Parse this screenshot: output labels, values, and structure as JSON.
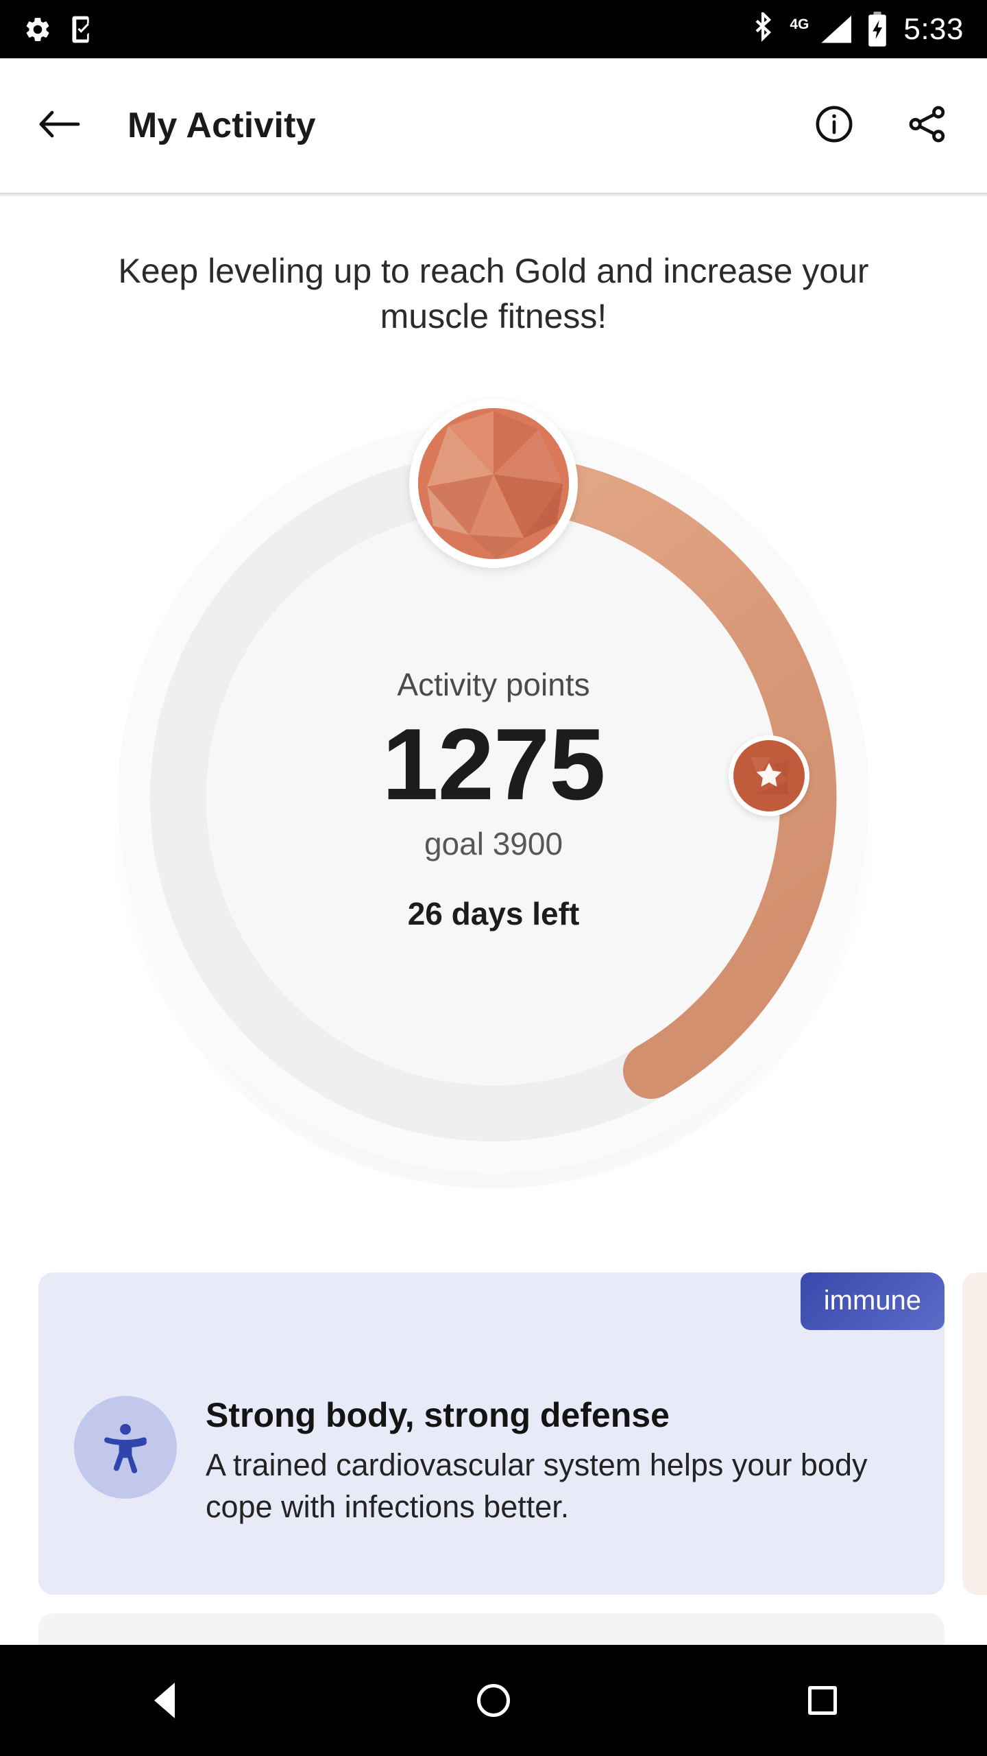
{
  "statusbar": {
    "time": "5:33",
    "network_label": "4G",
    "icons": [
      "settings-gear-icon",
      "phone-check-icon",
      "bluetooth-icon",
      "signal-4g-icon",
      "battery-charging-icon"
    ]
  },
  "appbar": {
    "title": "My Activity",
    "back_label": "Back",
    "info_label": "Info",
    "share_label": "Share"
  },
  "headline": "Keep leveling up to reach Gold and increase your muscle fitness!",
  "ring": {
    "label": "Activity points",
    "value": "1275",
    "goal": "goal 3900",
    "days_left": "26 days left",
    "points": 1275,
    "goal_points": 3900,
    "progress_percent": 33,
    "arc_color": "#d89878",
    "track_color": "#efefef",
    "gem_color": "#d9795a",
    "star_color": "#c05c3c"
  },
  "cards": [
    {
      "badge": "immune",
      "badge_color": "#3949ab",
      "title": "Strong body, strong defense",
      "description": "A trained cardiovascular system helps your body cope with infections better.",
      "icon": "accessibility-icon",
      "background": "#e8eaf8"
    },
    {
      "background": "#faeeea"
    }
  ],
  "navbar": {
    "back_label": "Back",
    "home_label": "Home",
    "recents_label": "Recents"
  }
}
